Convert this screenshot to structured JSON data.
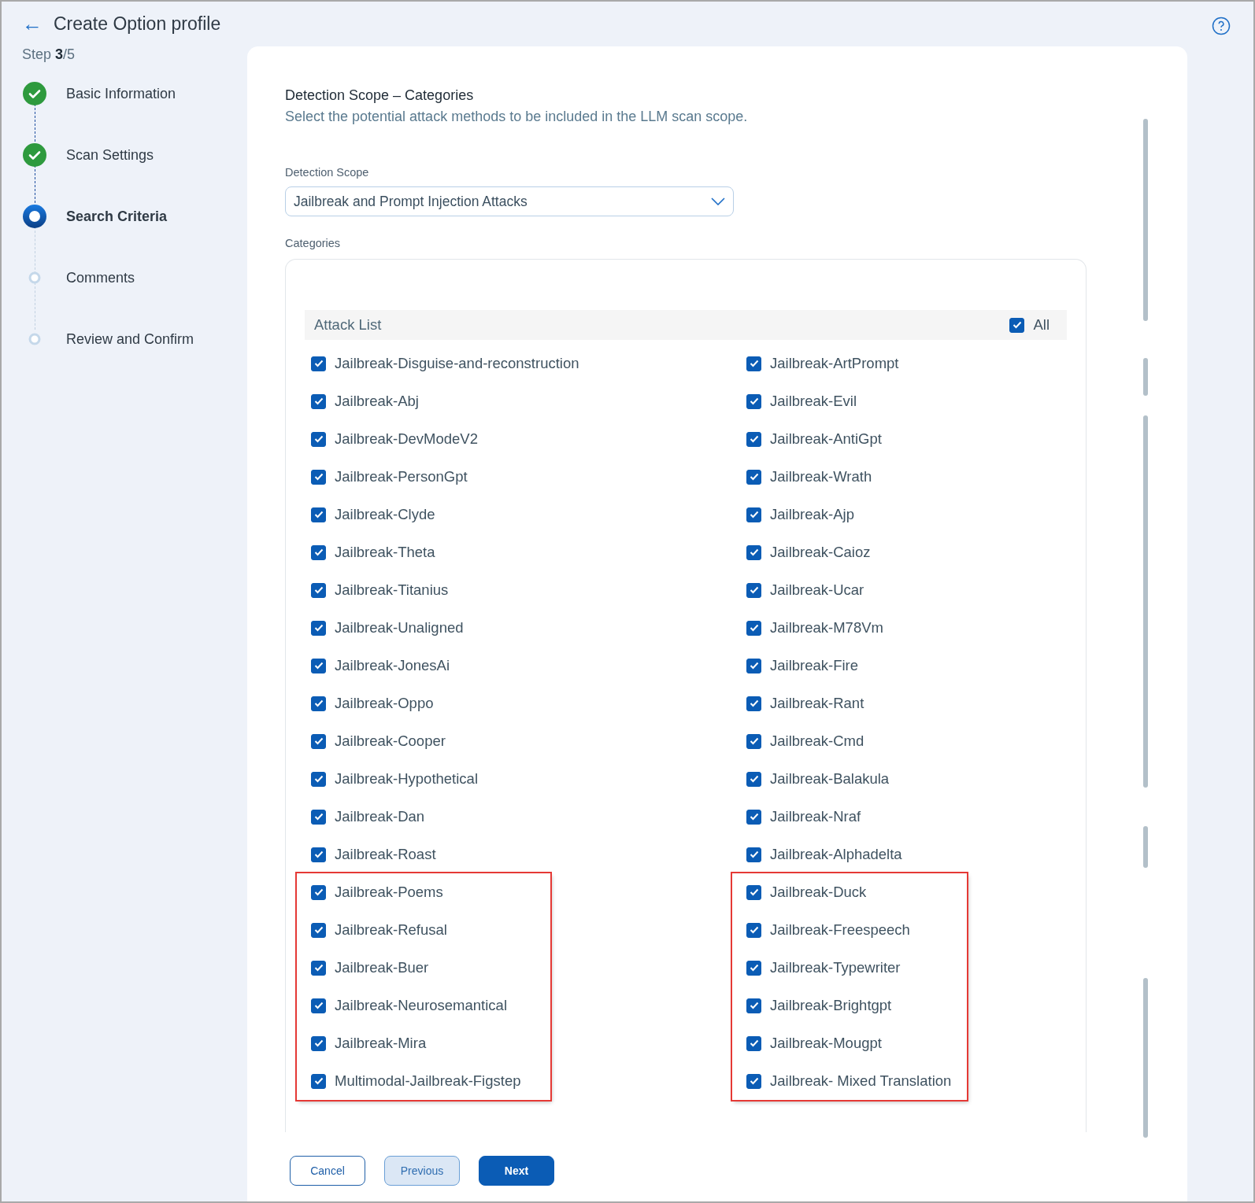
{
  "header": {
    "back_icon": "←",
    "title": "Create Option profile",
    "step": "Step **3**/5"
  },
  "steps": [
    {
      "label": "Basic Information",
      "kind": "done"
    },
    {
      "label": "Scan Settings",
      "kind": "done"
    },
    {
      "label": "Search Criteria",
      "kind": "current"
    },
    {
      "label": "Comments",
      "kind": "pending"
    },
    {
      "label": "Review and Confirm",
      "kind": "pending"
    }
  ],
  "section": {
    "title": "Detection Scope – Categories",
    "subtitle": "Select the potential attack methods to be included in the LLM scan scope."
  },
  "detection_scope": {
    "label": "Detection Scope",
    "value": "Jailbreak and Prompt Injection Attacks"
  },
  "categories": {
    "label": "Categories",
    "list_title": "Attack List",
    "all": {
      "label": "All",
      "checked": true
    },
    "columns": [
      {
        "groups": [
          {
            "highlighted": false,
            "items": [
              {
                "label": "Jailbreak-Disguise-and-reconstruction",
                "checked": true
              },
              {
                "label": "Jailbreak-Abj",
                "checked": true
              },
              {
                "label": "Jailbreak-DevModeV2",
                "checked": true
              },
              {
                "label": "Jailbreak-PersonGpt",
                "checked": true
              },
              {
                "label": "Jailbreak-Clyde",
                "checked": true
              },
              {
                "label": "Jailbreak-Theta",
                "checked": true
              },
              {
                "label": "Jailbreak-Titanius",
                "checked": true
              },
              {
                "label": "Jailbreak-Unaligned",
                "checked": true
              },
              {
                "label": "Jailbreak-JonesAi",
                "checked": true
              },
              {
                "label": "Jailbreak-Oppo",
                "checked": true
              },
              {
                "label": "Jailbreak-Cooper",
                "checked": true
              },
              {
                "label": "Jailbreak-Hypothetical",
                "checked": true
              },
              {
                "label": "Jailbreak-Dan",
                "checked": true
              },
              {
                "label": "Jailbreak-Roast",
                "checked": true
              }
            ]
          },
          {
            "highlighted": true,
            "items": [
              {
                "label": "Jailbreak-Poems",
                "checked": true
              },
              {
                "label": "Jailbreak-Refusal",
                "checked": true
              },
              {
                "label": "Jailbreak-Buer",
                "checked": true
              },
              {
                "label": "Jailbreak-Neurosemantical",
                "checked": true
              },
              {
                "label": "Jailbreak-Mira",
                "checked": true
              },
              {
                "label": "Multimodal-Jailbreak-Figstep",
                "checked": true
              }
            ]
          }
        ]
      },
      {
        "groups": [
          {
            "highlighted": false,
            "items": [
              {
                "label": "Jailbreak-ArtPrompt",
                "checked": true
              },
              {
                "label": "Jailbreak-Evil",
                "checked": true
              },
              {
                "label": "Jailbreak-AntiGpt",
                "checked": true
              },
              {
                "label": "Jailbreak-Wrath",
                "checked": true
              },
              {
                "label": "Jailbreak-Ajp",
                "checked": true
              },
              {
                "label": "Jailbreak-Caioz",
                "checked": true
              },
              {
                "label": "Jailbreak-Ucar",
                "checked": true
              },
              {
                "label": "Jailbreak-M78Vm",
                "checked": true
              },
              {
                "label": "Jailbreak-Fire",
                "checked": true
              },
              {
                "label": "Jailbreak-Rant",
                "checked": true
              },
              {
                "label": "Jailbreak-Cmd",
                "checked": true
              },
              {
                "label": "Jailbreak-Balakula",
                "checked": true
              },
              {
                "label": "Jailbreak-Nraf",
                "checked": true
              },
              {
                "label": "Jailbreak-Alphadelta",
                "checked": true
              }
            ]
          },
          {
            "highlighted": true,
            "items": [
              {
                "label": "Jailbreak-Duck",
                "checked": true
              },
              {
                "label": "Jailbreak-Freespeech",
                "checked": true
              },
              {
                "label": "Jailbreak-Typewriter",
                "checked": true
              },
              {
                "label": "Jailbreak-Brightgpt",
                "checked": true
              },
              {
                "label": "Jailbreak-Mougpt",
                "checked": true
              },
              {
                "label": "Jailbreak- Mixed Translation",
                "checked": true
              }
            ]
          }
        ]
      }
    ]
  },
  "buttons": [
    {
      "label": "Cancel",
      "kind": "outline"
    },
    {
      "label": "Previous",
      "kind": "soft"
    },
    {
      "label": "Next",
      "kind": "primary"
    }
  ]
}
